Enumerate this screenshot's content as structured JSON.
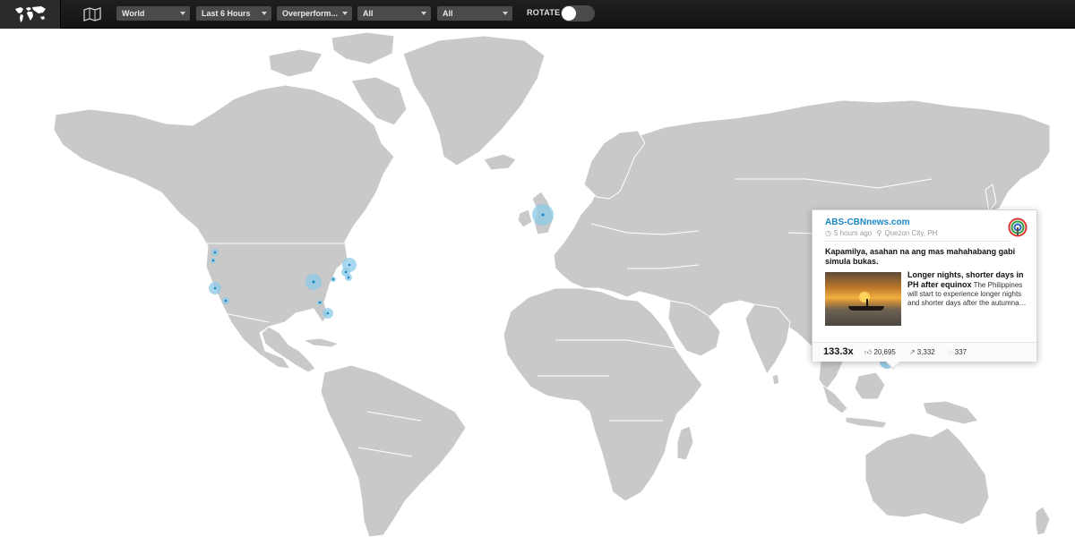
{
  "toolbar": {
    "logo_icon": "world-map-icon",
    "mapview_icon": "flat-map-icon",
    "dropdowns": [
      {
        "label": "World"
      },
      {
        "label": "Last 6 Hours"
      },
      {
        "label": "Overperform..."
      },
      {
        "label": "All"
      },
      {
        "label": "All"
      }
    ],
    "rotate_label": "ROTATE",
    "rotate_on": false
  },
  "colors": {
    "toolbar_bg": "#1a1a1a",
    "land": "#c9c9c9",
    "bubble": "#8cc9e8",
    "link": "#1a87c9"
  },
  "popup": {
    "source": "ABS-CBNnews.com",
    "time": "5 hours ago",
    "location": "Quezon City, PH",
    "headline": "Kapamilya, asahan na ang mas mahahabang gabi simula bukas.",
    "story_title": "Longer nights, shorter days in PH after equinox",
    "story_text": "The Philippines will start to experience longer nights and shorter days after the autumna…",
    "score": "133.3x",
    "likes": "20,695",
    "shares": "3,332",
    "comments": "337"
  }
}
